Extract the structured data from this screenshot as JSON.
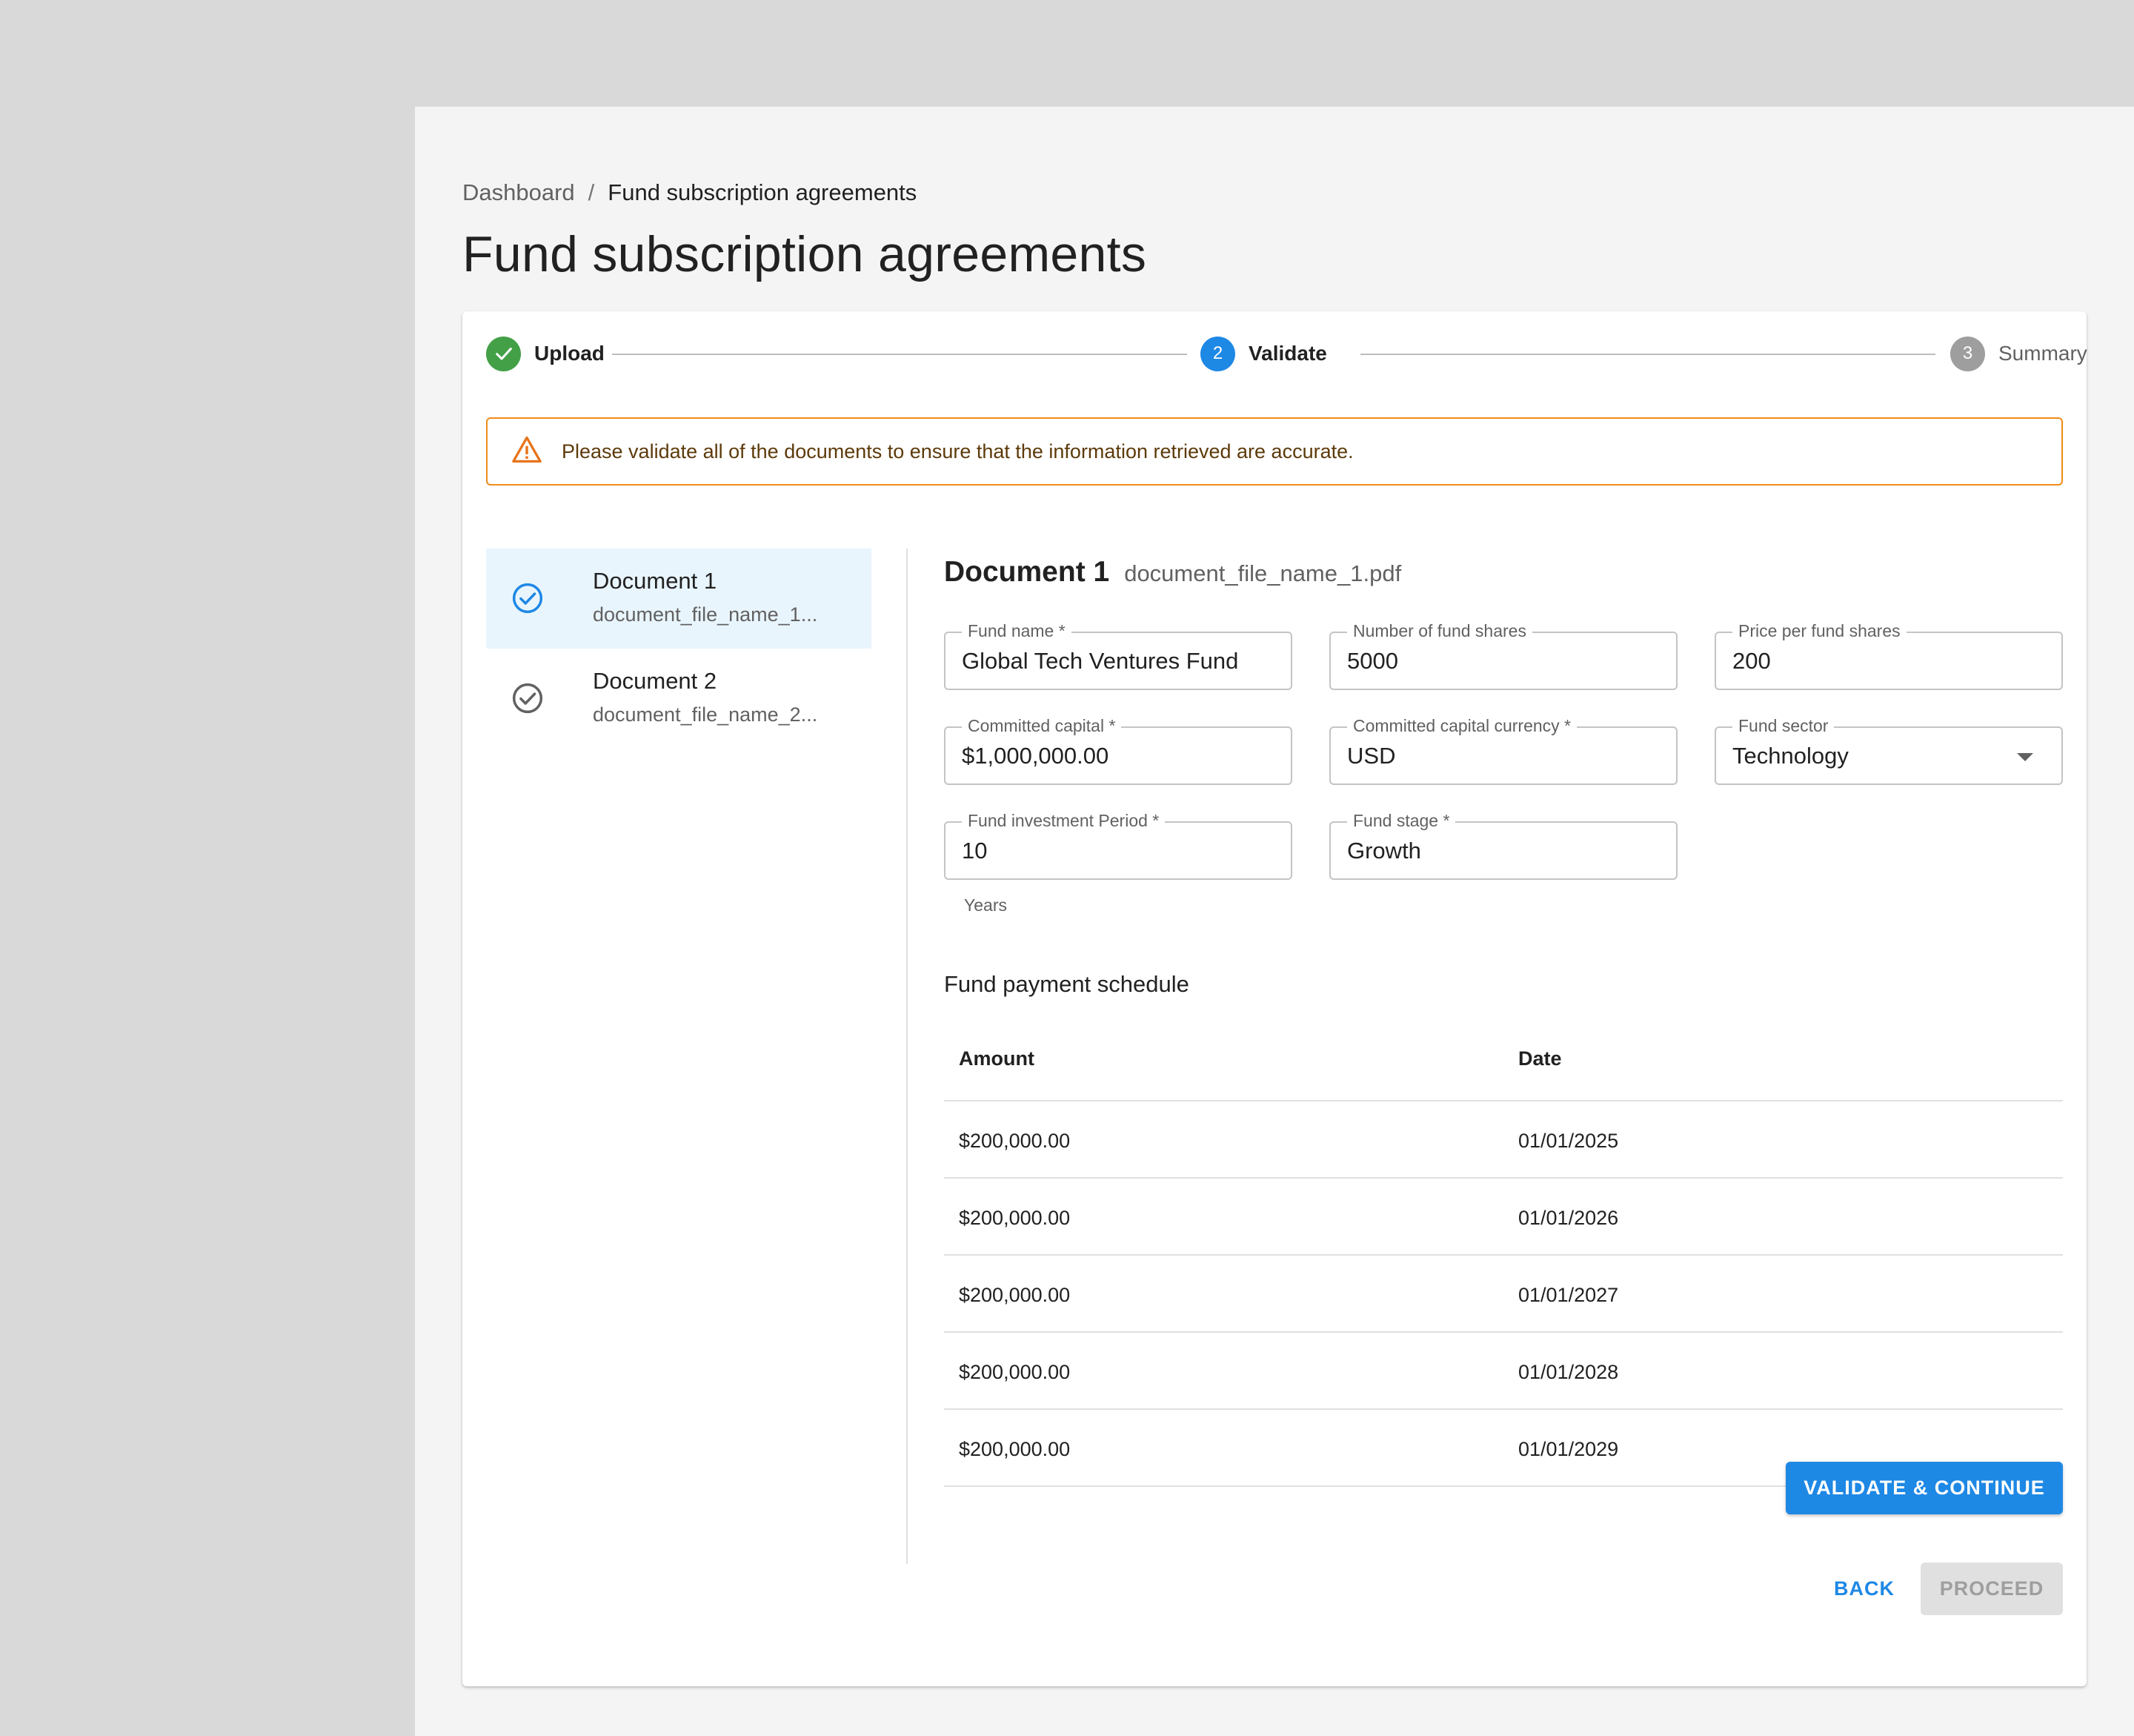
{
  "breadcrumb": {
    "root": "Dashboard",
    "separator": "/",
    "current": "Fund subscription agreements"
  },
  "page_title": "Fund subscription agreements",
  "stepper": {
    "steps": [
      {
        "label": "Upload",
        "status": "completed",
        "icon": "check-icon"
      },
      {
        "label": "Validate",
        "number": "2",
        "status": "active"
      },
      {
        "label": "Summary",
        "number": "3",
        "status": "pending"
      }
    ]
  },
  "alert": {
    "icon": "warning-icon",
    "text": "Please validate all of the documents to ensure that the information retrieved are accurate."
  },
  "documents": [
    {
      "title": "Document 1",
      "file": "document_file_name_1...",
      "selected": true,
      "icon": "check-circle-icon"
    },
    {
      "title": "Document 2",
      "file": "document_file_name_2...",
      "selected": false,
      "icon": "check-circle-icon"
    }
  ],
  "detail": {
    "title": "Document 1",
    "file": "document_file_name_1.pdf",
    "fields": {
      "fund_name": {
        "label": "Fund name *",
        "value": "Global Tech Ventures Fund"
      },
      "num_shares": {
        "label": "Number of fund shares",
        "value": "5000"
      },
      "price_per_share": {
        "label": "Price per fund shares",
        "value": "200"
      },
      "committed_capital": {
        "label": "Committed capital *",
        "value": "$1,000,000.00"
      },
      "capital_currency": {
        "label": "Committed capital currency *",
        "value": "USD"
      },
      "fund_sector": {
        "label": "Fund sector",
        "value": "Technology"
      },
      "investment_period": {
        "label": "Fund investment Period *",
        "value": "10",
        "helper": "Years"
      },
      "fund_stage": {
        "label": "Fund stage *",
        "value": "Growth"
      }
    },
    "schedule": {
      "title": "Fund payment schedule",
      "headers": [
        "Amount",
        "Date"
      ],
      "rows": [
        [
          "$200,000.00",
          "01/01/2025"
        ],
        [
          "$200,000.00",
          "01/01/2026"
        ],
        [
          "$200,000.00",
          "01/01/2027"
        ],
        [
          "$200,000.00",
          "01/01/2028"
        ],
        [
          "$200,000.00",
          "01/01/2029"
        ]
      ]
    },
    "validate_button": "VALIDATE & CONTINUE"
  },
  "footer": {
    "back": "BACK",
    "proceed": "PROCEED"
  },
  "colors": {
    "primary": "#1e88e5",
    "success": "#43a047",
    "warning": "#ef8c1a",
    "pending": "#9e9e9e",
    "selected_bg": "#e9f5fd"
  }
}
